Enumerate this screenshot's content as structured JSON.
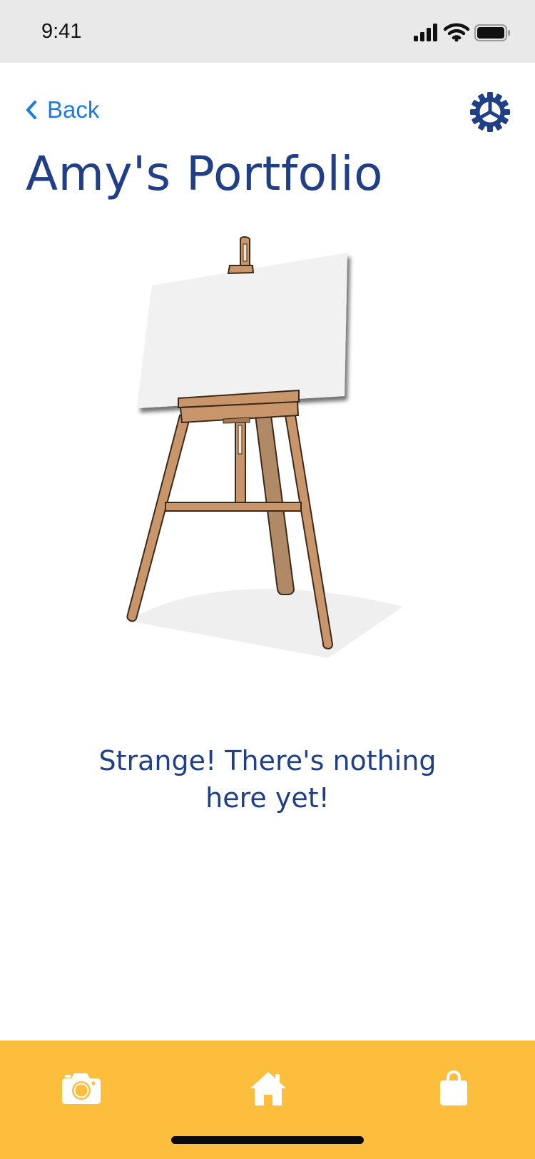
{
  "status_bar": {
    "time": "9:41"
  },
  "nav": {
    "back_label": "Back",
    "settings_icon": "gear-icon"
  },
  "page": {
    "title": "Amy's Portfolio",
    "illustration": "empty-easel",
    "empty_message": "Strange! There's nothing here yet!"
  },
  "tab_bar": {
    "tabs": [
      {
        "icon": "camera-icon"
      },
      {
        "icon": "home-icon"
      },
      {
        "icon": "shopping-bag-icon"
      }
    ]
  },
  "colors": {
    "accent_blue": "#1a7be6",
    "title_navy": "#213f86",
    "tab_bar_yellow": "#fdbd3d",
    "status_bar_gray": "#e9e9e9"
  }
}
